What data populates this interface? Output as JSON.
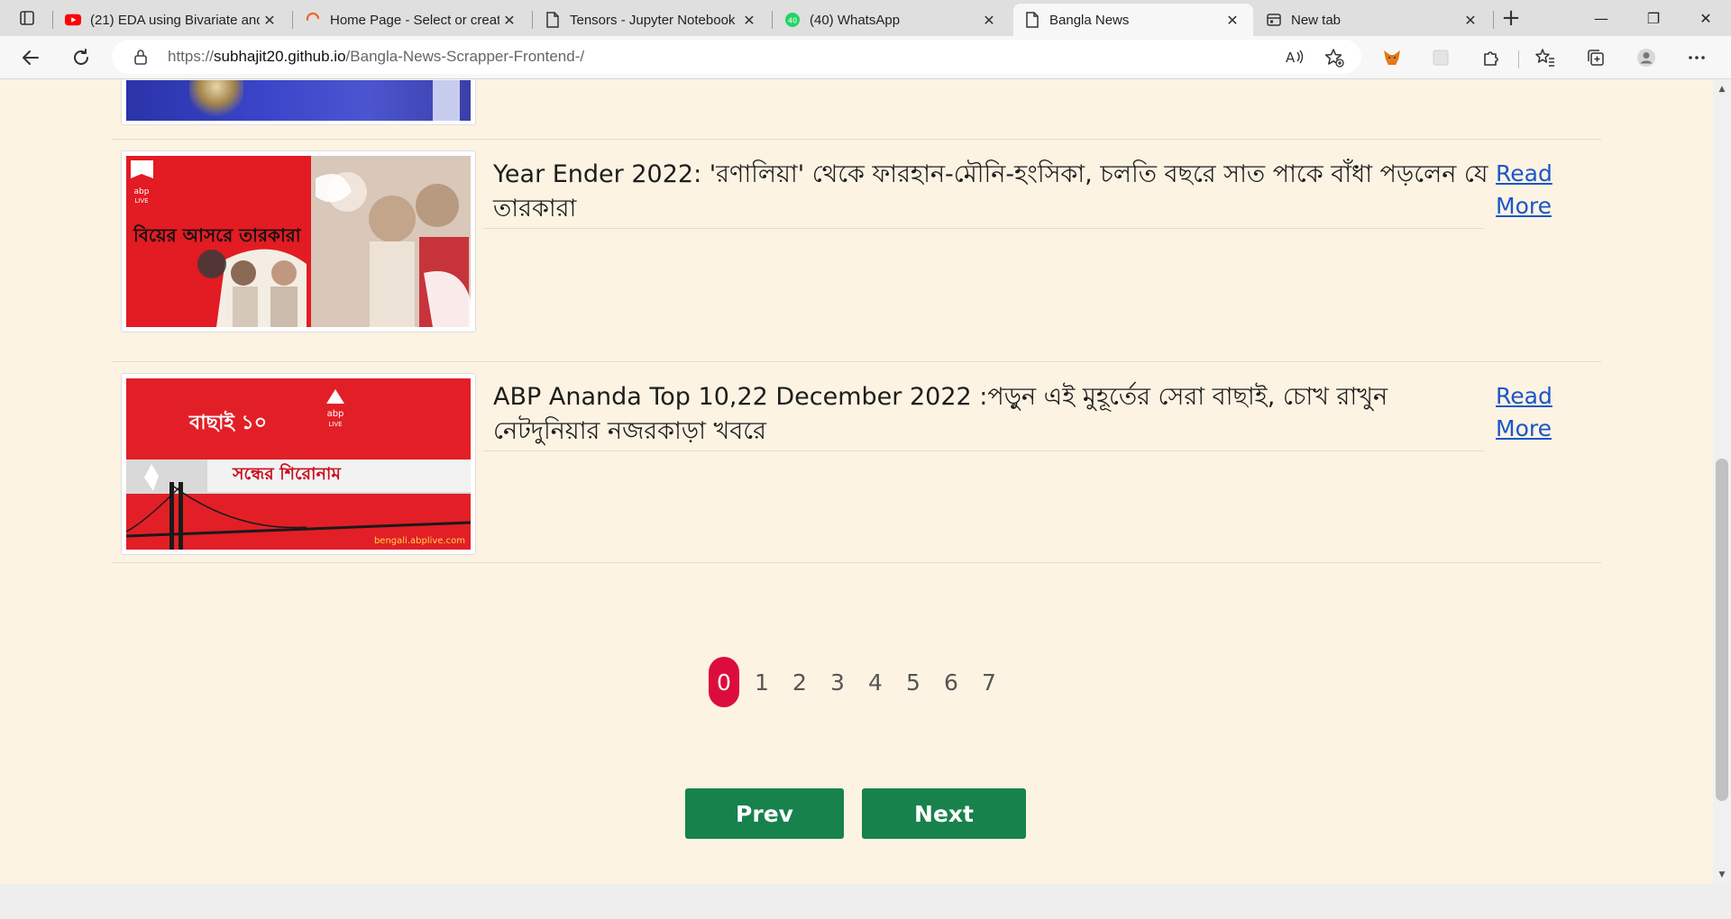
{
  "browser": {
    "tabs": [
      {
        "title": "(21) EDA using Bivariate and",
        "icon": "youtube-icon",
        "color": "#ff0000"
      },
      {
        "title": "Home Page - Select or creat",
        "icon": "loading-spinner-icon",
        "color": "#f26522"
      },
      {
        "title": "Tensors - Jupyter Notebook",
        "icon": "page-icon"
      },
      {
        "title": "(40) WhatsApp",
        "icon": "whatsapp-icon",
        "color": "#25d366",
        "badge": "40"
      },
      {
        "title": "Bangla News",
        "icon": "page-icon",
        "active": true
      },
      {
        "title": "New tab",
        "icon": "new-tab-page-icon"
      }
    ],
    "close_glyph": "✕",
    "new_tab_glyph": "+",
    "window_controls": {
      "minimize": "—",
      "restore": "❐",
      "close": "✕"
    },
    "address": {
      "scheme": "https://",
      "host": "subhajit20.github.io",
      "path": "/Bangla-News-Scrapper-Frontend-/"
    }
  },
  "news": {
    "items": [
      {
        "title": "Year Ender 2022: 'রণালিয়া' থেকে ফারহান-মৌনি-হংসিকা, চলতি বছরে সাত পাকে বাঁধা পড়লেন যে তারকারা",
        "read_more": "Read More",
        "image_caption": "বিয়ের আসরে তারকারা",
        "image_logo": "abp LIVE"
      },
      {
        "title": "ABP Ananda Top 10,22 December 2022 :পড়ুন এই মুহূর্তের সেরা বাছাই, চোখ রাখুন নেটদুনিয়ার নজরকাড়া খবরে",
        "read_more": "Read More",
        "image_caption": "সন্ধের শিরোনাম",
        "image_badge": "বাছাই ১০",
        "image_logo": "abp LIVE",
        "image_url": "bengali.abplive.com"
      }
    ]
  },
  "pagination": {
    "pages": [
      "0",
      "1",
      "2",
      "3",
      "4",
      "5",
      "6",
      "7"
    ],
    "active": "0",
    "prev_label": "Prev",
    "next_label": "Next",
    "active_color": "#dc0d3c",
    "button_color": "#17824c"
  }
}
